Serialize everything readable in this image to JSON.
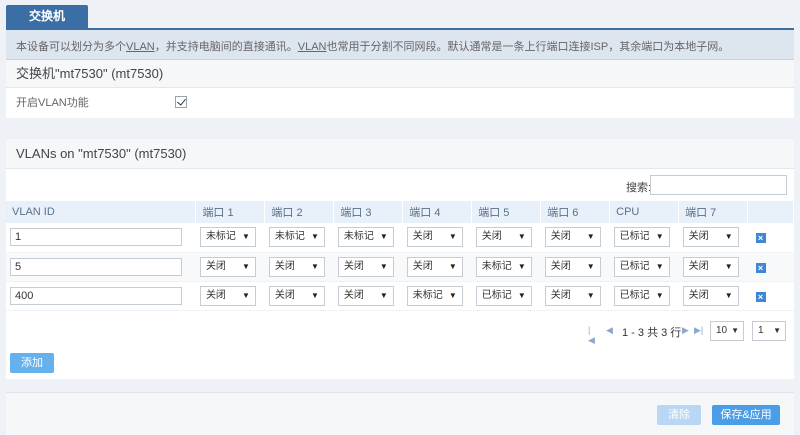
{
  "tab": {
    "label": "交换机"
  },
  "description": {
    "part1": "本设备可以划分为多个",
    "vlan1": "VLAN",
    "part2": "，并支持电脑间的直接通讯。",
    "vlan2": "VLAN",
    "part3": "也常用于分割不同网段。默认通常是一条上行端口连接ISP，其余端口为本地子网。"
  },
  "switch_section": {
    "title": "交换机\"mt7530\" (mt7530)",
    "enable_vlan_label": "开启VLAN功能",
    "enable_vlan_checked": true
  },
  "vlan_section": {
    "title": "VLANs on \"mt7530\" (mt7530)",
    "search_label": "搜索:",
    "columns": [
      "VLAN ID",
      "端口 1",
      "端口 2",
      "端口 3",
      "端口 4",
      "端口 5",
      "端口 6",
      "CPU",
      "端口 7"
    ],
    "rows": [
      {
        "id": "1",
        "ports": [
          "未标记",
          "未标记",
          "未标记",
          "关闭",
          "关闭",
          "关闭",
          "已标记",
          "关闭"
        ]
      },
      {
        "id": "5",
        "ports": [
          "关闭",
          "关闭",
          "关闭",
          "关闭",
          "未标记",
          "关闭",
          "已标记",
          "关闭"
        ]
      },
      {
        "id": "400",
        "ports": [
          "关闭",
          "关闭",
          "关闭",
          "未标记",
          "已标记",
          "关闭",
          "已标记",
          "关闭"
        ]
      }
    ],
    "delete_glyph": "×",
    "pager": {
      "info": "1 - 3 共 3 行",
      "page_size": "10",
      "page": "1"
    },
    "add_label": "添加"
  },
  "footer": {
    "clear_label": "清除",
    "save_label": "保存&应用"
  }
}
